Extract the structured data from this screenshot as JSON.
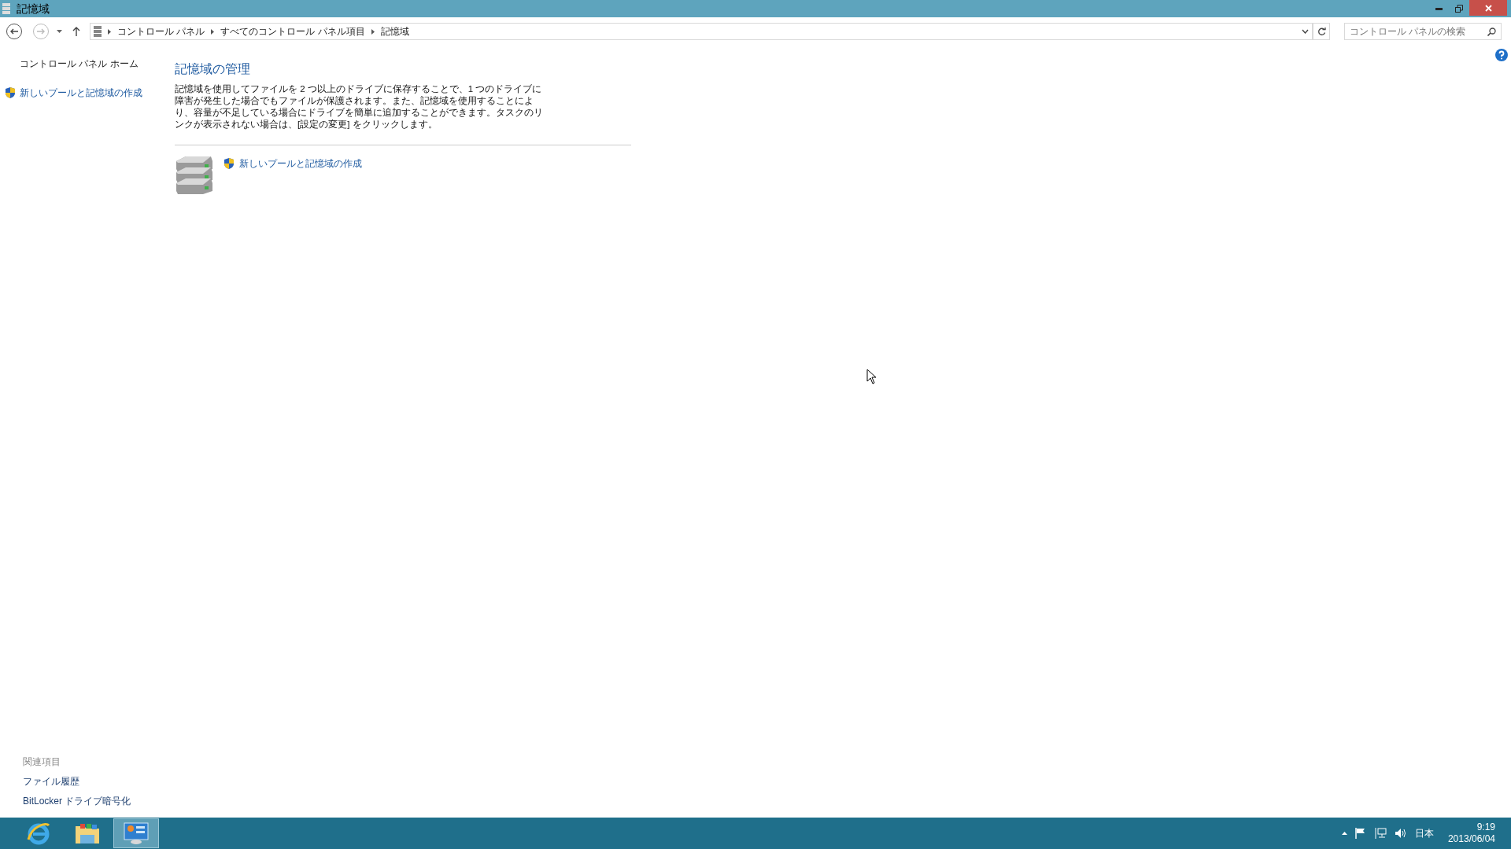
{
  "window": {
    "title": "記憶域"
  },
  "address_bar": {
    "breadcrumbs": [
      "コントロール パネル",
      "すべてのコントロール パネル項目",
      "記憶域"
    ]
  },
  "search": {
    "placeholder": "コントロール パネルの検索"
  },
  "sidebar": {
    "items": [
      {
        "label": "コントロール パネル ホーム",
        "kind": "link"
      },
      {
        "label": "新しいプールと記憶域の作成",
        "kind": "admin_link"
      }
    ]
  },
  "main": {
    "heading": "記憶域の管理",
    "description": "記憶域を使用してファイルを 2 つ以上のドライブに保存することで、1 つのドライブに障害が発生した場合でもファイルが保護されます。また、記憶域を使用することにより、容量が不足している場合にドライブを簡単に追加することができます。タスクのリンクが表示されない場合は、[設定の変更] をクリックします。",
    "tasks": [
      {
        "label": "新しいプールと記憶域の作成",
        "kind": "admin_link"
      }
    ]
  },
  "related": {
    "title": "関連項目",
    "links": [
      "ファイル履歴",
      "BitLocker ドライブ暗号化"
    ]
  },
  "taskbar": {
    "apps": [
      {
        "kind": "browser",
        "selected": false
      },
      {
        "kind": "explorer",
        "selected": false
      },
      {
        "kind": "control_panel",
        "selected": true
      }
    ],
    "language": "日本",
    "time": "9:19",
    "date": "2013/06/04"
  }
}
